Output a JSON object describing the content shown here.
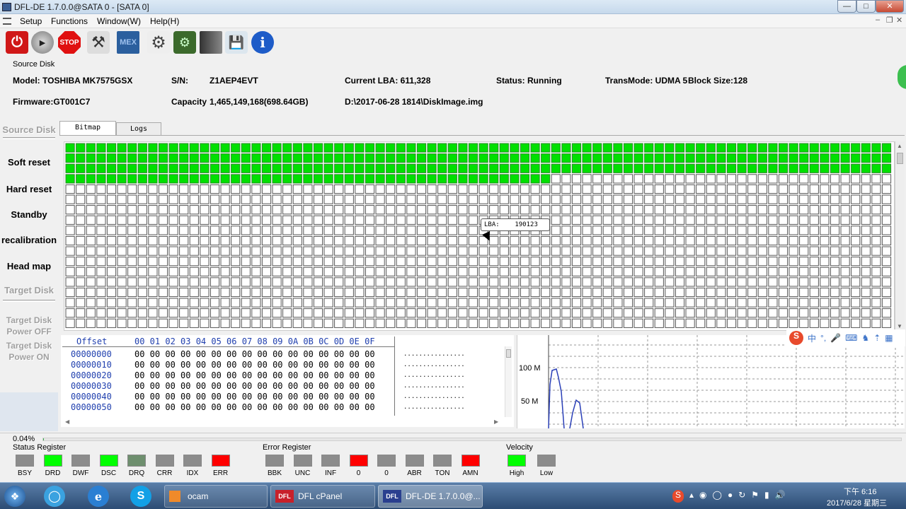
{
  "window": {
    "title": "DFL-DE 1.7.0.0@SATA 0 - [SATA 0]"
  },
  "menu": {
    "setup": "Setup",
    "functions": "Functions",
    "window": "Window(W)",
    "help": "Help(H)"
  },
  "toolbar": {
    "mex_label": "MEX",
    "stop_label": "STOP"
  },
  "source_info": {
    "section_title": "Source Disk",
    "model": "Model: TOSHIBA MK7575GSX",
    "sn_label": "S/N:",
    "sn_value": "Z1AEP4EVT",
    "current_lba": "Current LBA:  611,328",
    "status": "Status: Running",
    "transmode": "TransMode: UDMA 5",
    "block_size": "Block Size:128",
    "firmware": "Firmware:GT001C7",
    "capacity_label": "Capacity",
    "capacity_value": "1,465,149,168(698.64GB)",
    "image_path": "D:\\2017-06-28 1814\\DiskImage.img"
  },
  "sidebar": {
    "source_disk": "Source Disk",
    "soft_reset": "Soft reset",
    "hard_reset": "Hard reset",
    "standby": "Standby",
    "recalibration": "recalibration",
    "head_map": "Head map",
    "target_disk": "Target Disk",
    "target_power_off_1": "Target Disk",
    "target_power_off_2": "Power OFF",
    "target_power_on_1": "Target Disk",
    "target_power_on_2": "Power ON"
  },
  "tabs": {
    "bitmap": "Bitmap",
    "logs": "Logs"
  },
  "bitmap": {
    "tooltip": "LBA:    190123",
    "cols": 80,
    "rows": 18,
    "filled_full_rows": 3,
    "filled_partial": 47,
    "fill_color": "#00e000"
  },
  "hex": {
    "offset_header": "Offset",
    "col_header": "00 01 02 03 04 05 06 07 08 09 0A 0B 0C 0D 0E 0F",
    "rows": [
      {
        "offset": "00000000",
        "bytes": "00 00 00 00 00 00 00 00 00 00 00 00 00 00 00 00",
        "ascii": "................"
      },
      {
        "offset": "00000010",
        "bytes": "00 00 00 00 00 00 00 00 00 00 00 00 00 00 00 00",
        "ascii": "................"
      },
      {
        "offset": "00000020",
        "bytes": "00 00 00 00 00 00 00 00 00 00 00 00 00 00 00 00",
        "ascii": "................"
      },
      {
        "offset": "00000030",
        "bytes": "00 00 00 00 00 00 00 00 00 00 00 00 00 00 00 00",
        "ascii": "................"
      },
      {
        "offset": "00000040",
        "bytes": "00 00 00 00 00 00 00 00 00 00 00 00 00 00 00 00",
        "ascii": "................"
      },
      {
        "offset": "00000050",
        "bytes": "00 00 00 00 00 00 00 00 00 00 00 00 00 00 00 00",
        "ascii": "................"
      }
    ]
  },
  "speed_graph": {
    "label_100": "100 M",
    "label_50": "50 M"
  },
  "progress": {
    "percent_text": "0.04%",
    "value": 0.04
  },
  "status_register": {
    "title": "Status Register",
    "items": [
      {
        "name": "BSY",
        "color": "#8c8c8c"
      },
      {
        "name": "DRD",
        "color": "#00ff00"
      },
      {
        "name": "DWF",
        "color": "#8c8c8c"
      },
      {
        "name": "DSC",
        "color": "#00ff00"
      },
      {
        "name": "DRQ",
        "color": "#6e8f6e"
      },
      {
        "name": "CRR",
        "color": "#8c8c8c"
      },
      {
        "name": "IDX",
        "color": "#8c8c8c"
      },
      {
        "name": "ERR",
        "color": "#ff0000"
      }
    ]
  },
  "error_register": {
    "title": "Error Register",
    "items": [
      {
        "name": "BBK",
        "color": "#8c8c8c"
      },
      {
        "name": "UNC",
        "color": "#8c8c8c"
      },
      {
        "name": "INF",
        "color": "#8c8c8c"
      },
      {
        "name": "0",
        "color": "#ff0000"
      },
      {
        "name": "0",
        "color": "#8c8c8c"
      },
      {
        "name": "ABR",
        "color": "#8c8c8c"
      },
      {
        "name": "TON",
        "color": "#8c8c8c"
      },
      {
        "name": "AMN",
        "color": "#ff0000"
      }
    ]
  },
  "velocity": {
    "title": "Velocity",
    "items": [
      {
        "name": "High",
        "color": "#00ff00"
      },
      {
        "name": "Low",
        "color": "#8c8c8c"
      }
    ]
  },
  "taskbar": {
    "ocam": "ocam",
    "dfl_cpanel": "DFL cPanel",
    "dfl_de": "DFL-DE 1.7.0.0@...",
    "time": "下午 6:16",
    "date": "2017/6/28 星期三"
  }
}
